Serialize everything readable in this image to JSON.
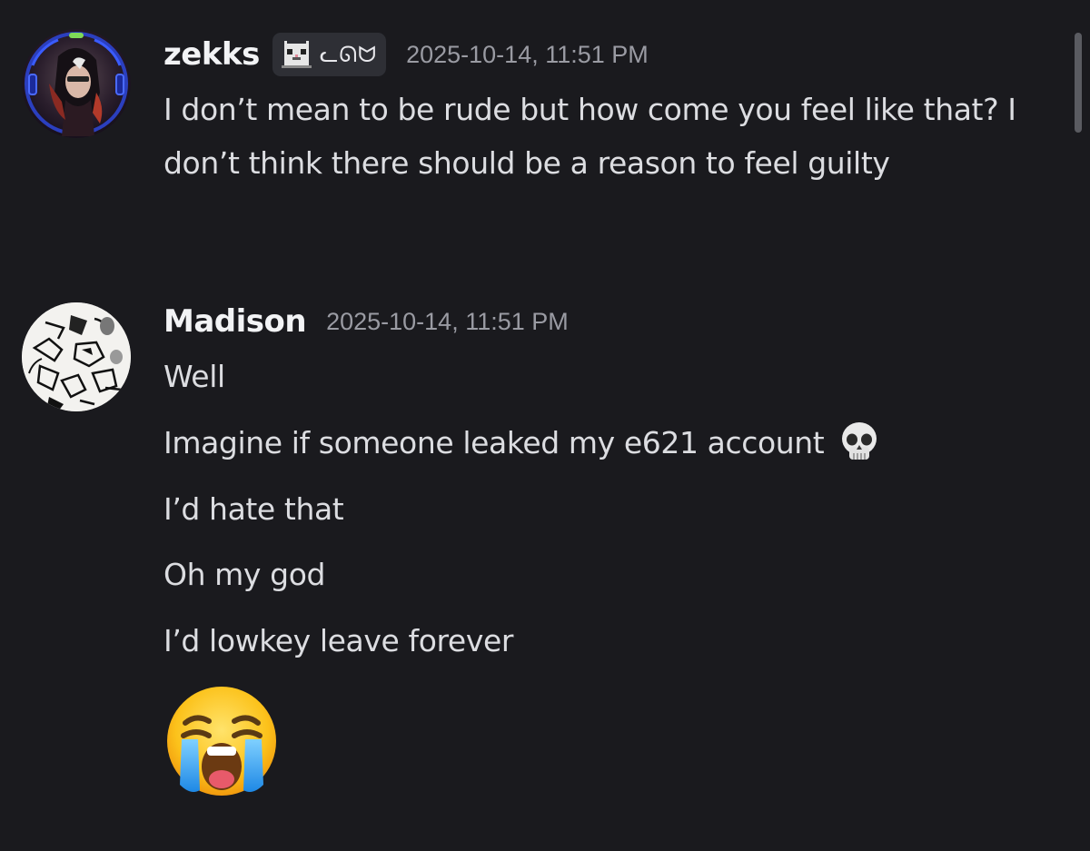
{
  "messages": [
    {
      "username": "zekks",
      "tag": {
        "icon": "pixel-cat-icon",
        "text": "ᓚᘏᗢ"
      },
      "timestamp": "2025-10-14, 11:51 PM",
      "content": "I don’t mean to be rude but how come you feel like that? I don’t think there should be a reason to feel guilty"
    },
    {
      "username": "Madison",
      "timestamp": "2025-10-14, 11:51 PM",
      "lines": [
        "Well",
        "Imagine if someone leaked my e621 account",
        "I’d hate that",
        "Oh my god",
        "I’d lowkey leave forever"
      ],
      "inline_emoji": "skull-emoji",
      "trailing_emoji": "loudly-crying-face-emoji"
    }
  ],
  "colors": {
    "background": "#1a1a1e",
    "username": "#f2f3f5",
    "text": "#dcdde1",
    "timestamp": "#9a9ba3",
    "tag_background": "#2e2f35"
  }
}
